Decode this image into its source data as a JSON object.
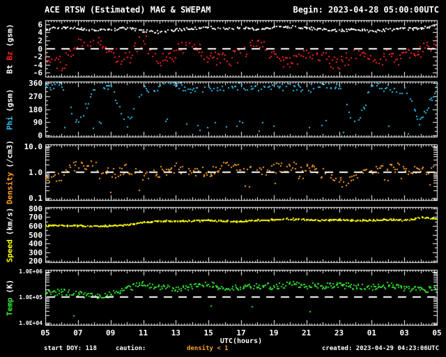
{
  "title": "ACE RTSW (Estimated) MAG & SWEPAM",
  "begin_label": "Begin: 2023-04-28 05:00:00UTC",
  "x_axis": {
    "label": "UTC(hours)",
    "tick_labels": [
      "05",
      "07",
      "09",
      "11",
      "13",
      "15",
      "17",
      "19",
      "21",
      "23",
      "01",
      "03",
      "05"
    ],
    "hours_span": 24
  },
  "footer": {
    "start_doy": "start DOY: 118",
    "caution_label": "caution:",
    "caution_value": "density < 1",
    "created": "created: 2023-04-29 04:23:06UTC"
  },
  "colors": {
    "background": "#000000",
    "frame": "#ffffff",
    "text": "#ffffff",
    "bt": "#ffffff",
    "bz": "#ff2222",
    "phi": "#2cc3f2",
    "density": "#ffa028",
    "speed": "#ffff00",
    "temp": "#33e833"
  },
  "chart_data": [
    {
      "type": "scatter",
      "name": "mag-bt-bz",
      "axis_label_parts": [
        {
          "text": "Bt",
          "color": "#ffffff"
        },
        {
          "text": "Bz",
          "color": "#ff2222"
        },
        {
          "text": "(gsm)",
          "color": "#ffffff"
        }
      ],
      "scale": "linear",
      "ylim": [
        -7,
        7
      ],
      "yticks": [
        {
          "v": 6,
          "label": "6"
        },
        {
          "v": 4,
          "label": "4"
        },
        {
          "v": 2,
          "label": "2"
        },
        {
          "v": 0,
          "label": "0"
        },
        {
          "v": -2,
          "label": "-2"
        },
        {
          "v": -4,
          "label": "-4"
        },
        {
          "v": -6,
          "label": "-6"
        }
      ],
      "minor_tick_step": 1,
      "dashed_line_at": 0,
      "series": [
        {
          "name": "Bt",
          "color": "#ffffff",
          "anchors": [
            4.8,
            5.1,
            4.9,
            4.4,
            4.7,
            5.0,
            4.3,
            4.0,
            4.6,
            5.0,
            5.2,
            4.9,
            5.1,
            4.8,
            5.2,
            5.4,
            5.0,
            4.7,
            4.4,
            4.8,
            4.3,
            4.6,
            4.9,
            5.0,
            5.7
          ],
          "jitter": 0.3,
          "jitter_mode": "linear",
          "points": 320,
          "drop": 0.15
        },
        {
          "name": "Bz",
          "color": "#ff2222",
          "anchors": [
            -1.5,
            -4.0,
            0.5,
            3.0,
            -1.0,
            -3.0,
            2.5,
            -3.5,
            -1.0,
            2.0,
            -2.0,
            -3.0,
            -1.5,
            1.5,
            -2.0,
            -3.5,
            -1.0,
            -2.5,
            -3.8,
            -1.5,
            -3.5,
            -2.0,
            -2.5,
            -0.5,
            2.0
          ],
          "jitter": 1.8,
          "jitter_mode": "linear",
          "points": 320,
          "drop": 0.15
        }
      ]
    },
    {
      "type": "scatter",
      "name": "phi",
      "axis_label_parts": [
        {
          "text": "Phi",
          "color": "#2cc3f2"
        },
        {
          "text": "(gsm)",
          "color": "#ffffff"
        }
      ],
      "scale": "linear",
      "ylim": [
        -8,
        368
      ],
      "yticks": [
        {
          "v": 360,
          "label": "360"
        },
        {
          "v": 270,
          "label": "270"
        },
        {
          "v": 180,
          "label": "180"
        },
        {
          "v": 90,
          "label": "90"
        },
        {
          "v": 0,
          "label": "0"
        }
      ],
      "minor_tick_step": 30,
      "dashed_line_at": null,
      "series": [
        {
          "name": "Phi",
          "color": "#2cc3f2",
          "anchors": [
            330,
            345,
            70,
            320,
            340,
            80,
            310,
            330,
            350,
            300,
            330,
            320,
            335,
            310,
            325,
            335,
            315,
            340,
            330,
            60,
            335,
            320,
            310,
            80,
            330
          ],
          "jitter": 28,
          "jitter_mode": "linear",
          "points": 300,
          "drop": 0.2,
          "band_flip": {
            "prob": 0.13,
            "delta": -255
          }
        }
      ]
    },
    {
      "type": "scatter",
      "name": "density",
      "axis_label_parts": [
        {
          "text": "Density",
          "color": "#ffa028"
        },
        {
          "text": "(/cm3)",
          "color": "#ffffff"
        }
      ],
      "scale": "log",
      "ylim": [
        0.085,
        11.75
      ],
      "yticks": [
        {
          "v": 10,
          "label": "10.0"
        },
        {
          "v": 1,
          "label": "1.0"
        },
        {
          "v": 0.1,
          "label": "0.1"
        }
      ],
      "minor_tick_step": null,
      "dashed_line_at": 1.0,
      "series": [
        {
          "name": "Density",
          "color": "#ffa028",
          "anchors": [
            0.45,
            0.7,
            2.0,
            1.8,
            0.8,
            1.3,
            0.6,
            1.0,
            1.5,
            1.1,
            0.9,
            1.6,
            1.2,
            1.0,
            1.4,
            1.7,
            1.3,
            0.9,
            0.4,
            0.5,
            1.1,
            1.6,
            1.3,
            1.0,
            1.2
          ],
          "jitter": 0.2,
          "jitter_mode": "dex",
          "points": 330,
          "drop": 0.18,
          "outlier": {
            "prob": 0.06,
            "factor": 0.3
          }
        }
      ]
    },
    {
      "type": "scatter",
      "name": "speed",
      "axis_label_parts": [
        {
          "text": "Speed",
          "color": "#ffff00"
        },
        {
          "text": "(km/s)",
          "color": "#ffffff"
        }
      ],
      "scale": "linear",
      "ylim": [
        185,
        815
      ],
      "yticks": [
        {
          "v": 800,
          "label": "800"
        },
        {
          "v": 700,
          "label": "700"
        },
        {
          "v": 600,
          "label": "600"
        },
        {
          "v": 500,
          "label": "500"
        },
        {
          "v": 400,
          "label": "400"
        },
        {
          "v": 300,
          "label": "300"
        },
        {
          "v": 200,
          "label": "200"
        }
      ],
      "minor_tick_step": 50,
      "dashed_line_at": null,
      "series": [
        {
          "name": "Speed",
          "color": "#ffff00",
          "anchors": [
            600,
            605,
            600,
            595,
            600,
            610,
            640,
            655,
            650,
            658,
            662,
            655,
            650,
            662,
            668,
            678,
            668,
            664,
            670,
            660,
            666,
            672,
            662,
            695,
            685
          ],
          "jitter": 9,
          "jitter_mode": "linear",
          "points": 420,
          "drop": 0.06
        }
      ]
    },
    {
      "type": "scatter",
      "name": "temp",
      "axis_label_parts": [
        {
          "text": "Temp",
          "color": "#33e833"
        },
        {
          "text": "(K)",
          "color": "#ffffff"
        }
      ],
      "scale": "log",
      "ylim": [
        8500,
        1175000
      ],
      "yticks": [
        {
          "v": 1000000,
          "label": "1.0E+06"
        },
        {
          "v": 100000,
          "label": "1.0E+05"
        },
        {
          "v": 10000,
          "label": "1.0E+04"
        }
      ],
      "minor_tick_step": null,
      "dashed_line_at": 100000,
      "series": [
        {
          "name": "Temp",
          "color": "#33e833",
          "anchors": [
            140000,
            160000,
            130000,
            115000,
            130000,
            220000,
            320000,
            260000,
            210000,
            260000,
            310000,
            230000,
            260000,
            290000,
            260000,
            310000,
            290000,
            260000,
            300000,
            270000,
            240000,
            290000,
            230000,
            190000,
            210000
          ],
          "jitter": 0.12,
          "jitter_mode": "dex",
          "points": 420,
          "drop": 0.06,
          "outlier": {
            "prob": 0.01,
            "factor": 0.12
          }
        }
      ]
    }
  ]
}
